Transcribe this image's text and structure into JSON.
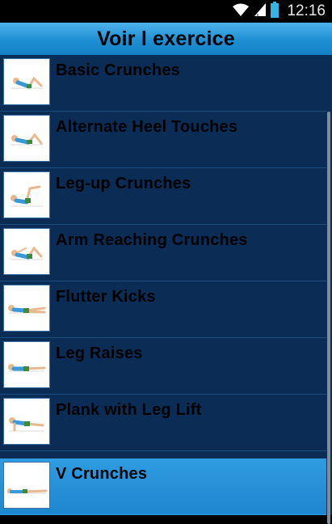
{
  "status_bar": {
    "time": "12:16",
    "icons": [
      "wifi-icon",
      "signal-icon",
      "battery-icon"
    ]
  },
  "header": {
    "title": "Voir l exercice"
  },
  "exercises": [
    {
      "label": "Basic Crunches",
      "icon": "basic-crunches-figure"
    },
    {
      "label": "Alternate Heel Touches",
      "icon": "heel-touches-figure"
    },
    {
      "label": "Leg-up Crunches",
      "icon": "leg-up-crunches-figure"
    },
    {
      "label": "Arm Reaching Crunches",
      "icon": "arm-reaching-figure"
    },
    {
      "label": "Flutter Kicks",
      "icon": "flutter-kicks-figure"
    },
    {
      "label": "Leg Raises",
      "icon": "leg-raises-figure"
    },
    {
      "label": "Plank with Leg Lift",
      "icon": "plank-figure"
    },
    {
      "label": "V Crunches",
      "icon": "v-crunches-figure",
      "selected": true
    }
  ],
  "colors": {
    "list_background": "#0a2c55",
    "header_accent": "#1d8fd4",
    "selected_row": "#2f9be0"
  }
}
